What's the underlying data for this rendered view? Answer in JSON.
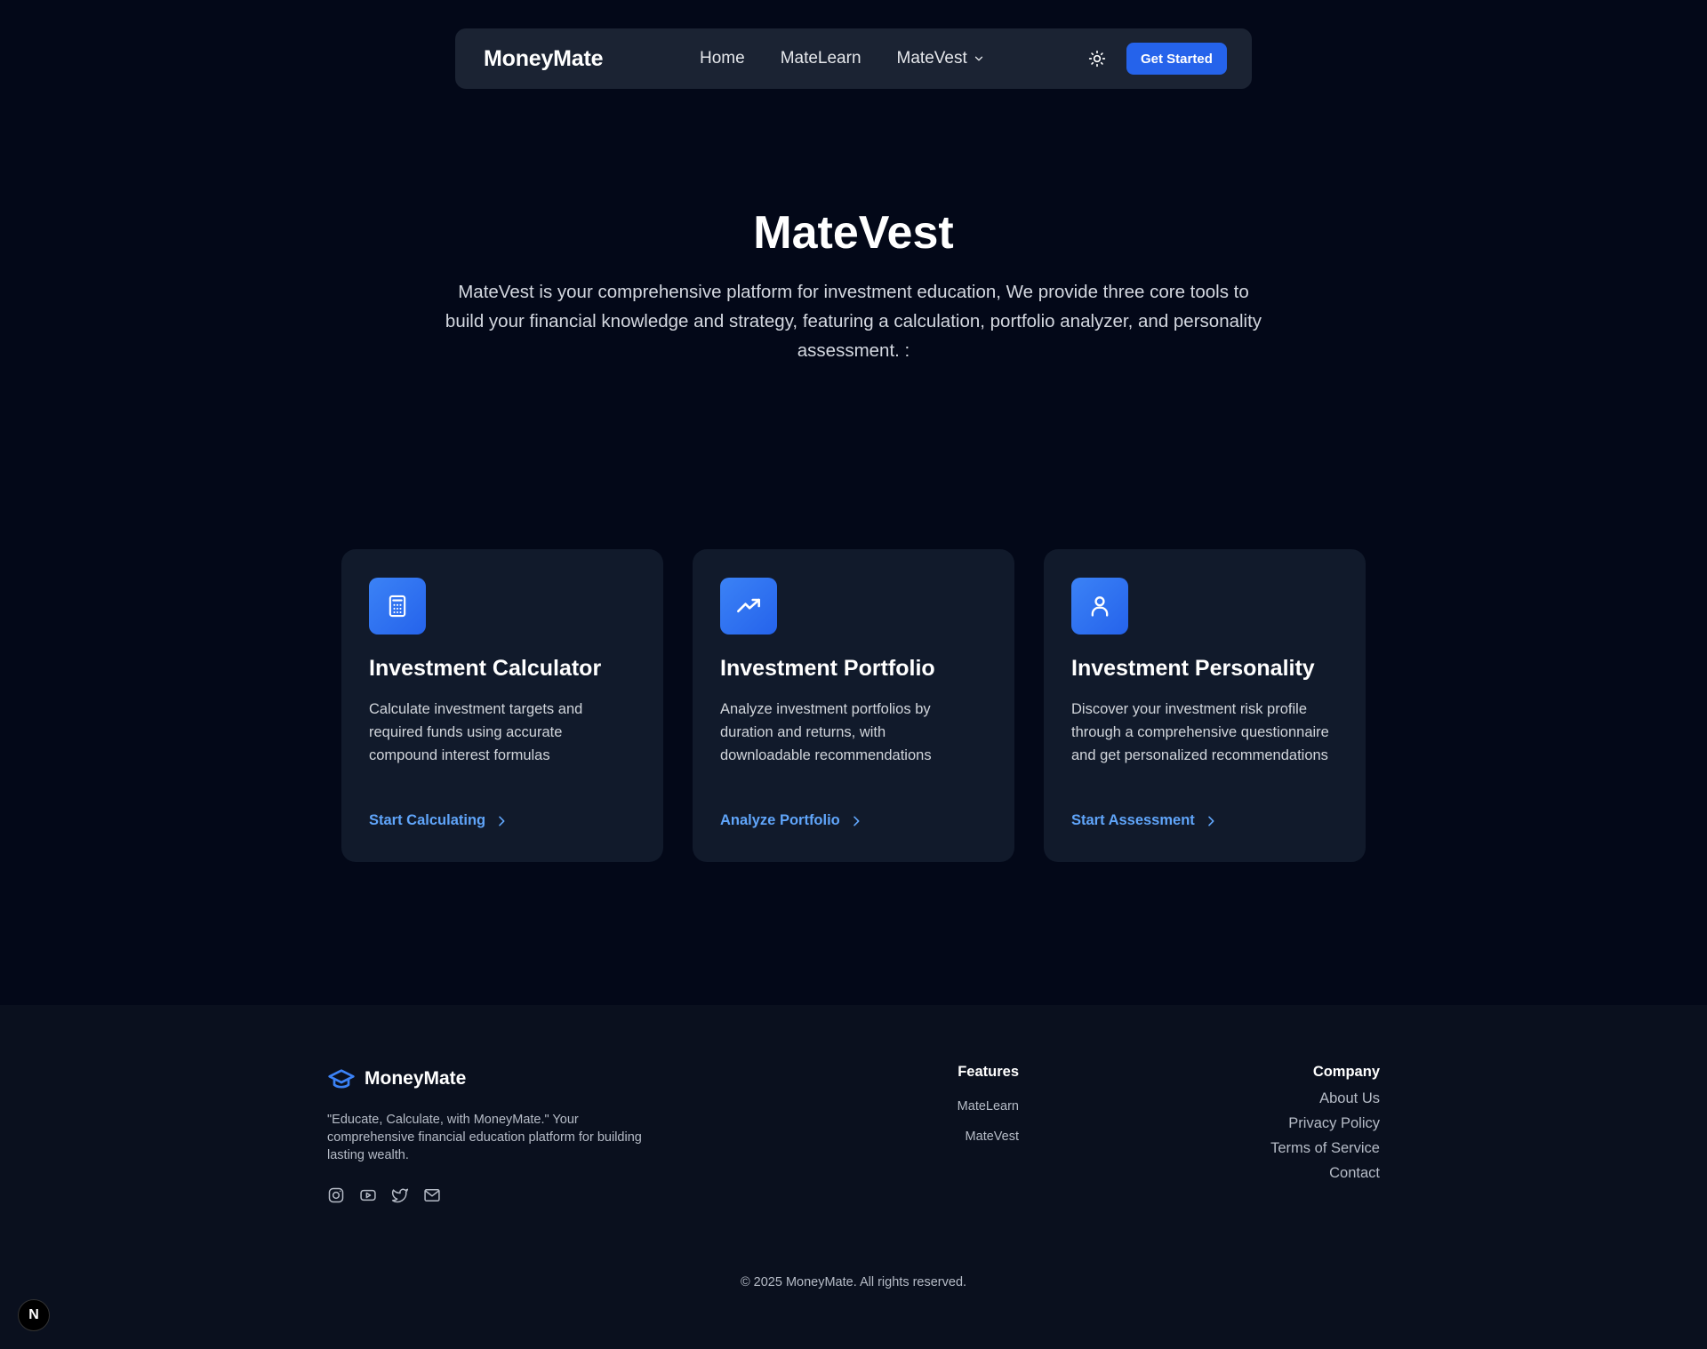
{
  "nav": {
    "brand": "MoneyMate",
    "links": [
      "Home",
      "MateLearn",
      "MateVest"
    ],
    "cta_label": "Get Started",
    "icons": {
      "theme": "sun-icon",
      "dropdown": "chevron-down-icon"
    }
  },
  "hero": {
    "title": "MateVest",
    "description": "MateVest is your comprehensive platform for investment education, We provide three core tools to build your financial knowledge and strategy, featuring a calculation, portfolio analyzer, and personality assessment. :"
  },
  "cards": [
    {
      "icon": "calculator-icon",
      "title": "Investment Calculator",
      "description": "Calculate investment targets and required funds using accurate compound interest formulas",
      "link": "Start Calculating"
    },
    {
      "icon": "trending-up-icon",
      "title": "Investment Portfolio",
      "description": "Analyze investment portfolios by duration and returns, with downloadable recommendations",
      "link": "Analyze Portfolio"
    },
    {
      "icon": "user-icon",
      "title": "Investment Personality",
      "description": "Discover your investment risk profile through a comprehensive questionnaire and get personalized recommendations",
      "link": "Start Assessment"
    }
  ],
  "footer": {
    "brand": "MoneyMate",
    "tagline": "\"Educate, Calculate, with MoneyMate.\" Your comprehensive financial education platform for building lasting wealth.",
    "features_heading": "Features",
    "features": [
      "MateLearn",
      "MateVest"
    ],
    "company_heading": "Company",
    "company": [
      "About Us",
      "Privacy Policy",
      "Terms of Service",
      "Contact"
    ],
    "copyright": "© 2025 MoneyMate. All rights reserved.",
    "socials": [
      "instagram-icon",
      "youtube-icon",
      "twitter-icon",
      "mail-icon"
    ]
  },
  "badge": "N",
  "colors": {
    "background": "#030818",
    "nav_bg": "#1b2333",
    "card_bg": "#111a2b",
    "accent": "#2563eb",
    "link": "#60a5fa",
    "footer_bg": "#0a101e"
  }
}
